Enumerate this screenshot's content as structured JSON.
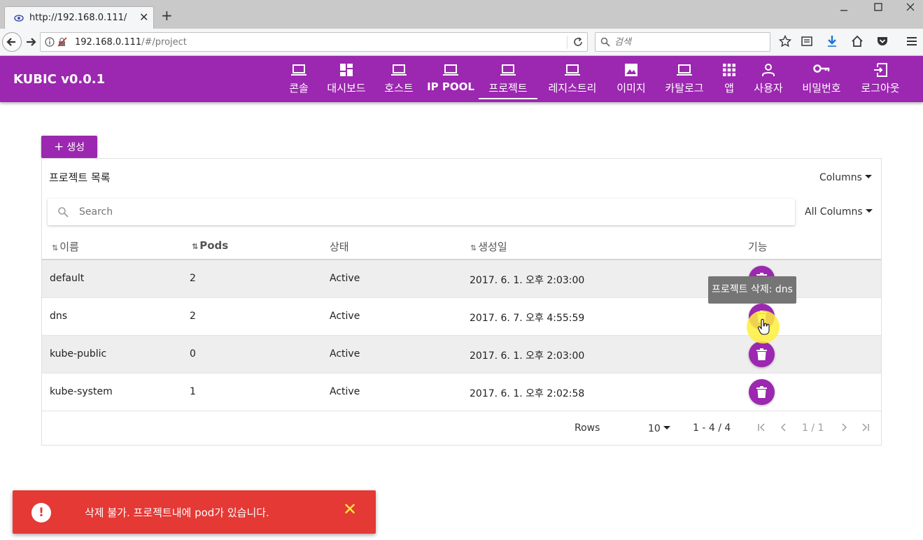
{
  "browser": {
    "tab_title": "http://192.168.0.111/",
    "tab_close": "✕",
    "new_tab": "+",
    "url_host": "192.168.0.111",
    "url_path": "/#/project",
    "search_placeholder": "검색"
  },
  "app": {
    "brand": "KUBIC v0.0.1",
    "menu": [
      {
        "label": "콘솔",
        "icon": "laptop-icon"
      },
      {
        "label": "대시보드",
        "icon": "dashboard-icon"
      },
      {
        "label": "호스트",
        "icon": "laptop-icon"
      },
      {
        "label": "IP POOL",
        "icon": "laptop-icon"
      },
      {
        "label": "프로젝트",
        "icon": "laptop-icon",
        "active": true
      },
      {
        "label": "레지스트리",
        "icon": "laptop-icon"
      },
      {
        "label": "이미지",
        "icon": "image-icon"
      },
      {
        "label": "카탈로그",
        "icon": "laptop-icon"
      },
      {
        "label": "앱",
        "icon": "apps-grid-icon"
      },
      {
        "label": "사용자",
        "icon": "person-icon"
      },
      {
        "label": "비밀번호",
        "icon": "key-icon"
      },
      {
        "label": "로그아웃",
        "icon": "exit-icon"
      }
    ]
  },
  "page": {
    "create_label": "생성",
    "card_title": "프로젝트 목록",
    "columns_label": "Columns",
    "all_columns_label": "All Columns",
    "search_placeholder": "Search",
    "headers": {
      "name": "이름",
      "pods": "Pods",
      "status": "상태",
      "created": "생성일",
      "actions": "기능"
    },
    "rows": [
      {
        "name": "default",
        "pods": "2",
        "status": "Active",
        "created": "2017. 6. 1. 오후 2:03:00"
      },
      {
        "name": "dns",
        "pods": "2",
        "status": "Active",
        "created": "2017. 6. 7. 오후 4:55:59"
      },
      {
        "name": "kube-public",
        "pods": "0",
        "status": "Active",
        "created": "2017. 6. 1. 오후 2:03:00"
      },
      {
        "name": "kube-system",
        "pods": "1",
        "status": "Active",
        "created": "2017. 6. 1. 오후 2:02:58"
      }
    ],
    "pager": {
      "rows_label": "Rows",
      "rows_per_page": "10",
      "range": "1 - 4 / 4",
      "page": "1 / 1"
    },
    "tooltip": "프로젝트 삭제: dns"
  },
  "snackbar": {
    "message": "삭제 불가. 프로젝트내에 pod가 있습니다.",
    "close": "✕",
    "color": "#e53935"
  },
  "colors": {
    "primary": "#9c27b0"
  }
}
